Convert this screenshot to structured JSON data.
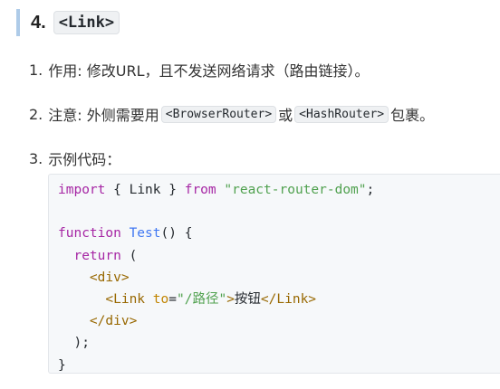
{
  "heading": {
    "number": "4.",
    "code": "<Link>"
  },
  "items": [
    {
      "num": "1.",
      "text": "作用: 修改URL，且不发送网络请求（路由链接）。"
    },
    {
      "num": "2.",
      "text_before": "注意: 外侧需要用",
      "code1": "<BrowserRouter>",
      "text_mid": "或",
      "code2": "<HashRouter>",
      "text_after": "包裹。"
    },
    {
      "num": "3.",
      "text": "示例代码："
    }
  ],
  "code": {
    "line1": {
      "import_kw": "import",
      "brace_open": " { ",
      "name": "Link",
      "brace_close": " } ",
      "from_kw": "from",
      "space": " ",
      "module": "\"react-router-dom\"",
      "semi": ";"
    },
    "line3": {
      "function_kw": "function",
      "space": " ",
      "name": "Test",
      "rest": "() {"
    },
    "line4": {
      "indent": "  ",
      "return_kw": "return",
      "rest": " ("
    },
    "line5": {
      "indent": "    ",
      "tag": "<div>"
    },
    "line6": {
      "indent": "      ",
      "tag_open": "<Link",
      "space": " ",
      "attr": "to",
      "eq": "=",
      "value": "\"/路径\"",
      "gt": ">",
      "text": "按钮",
      "tag_close": "</Link>"
    },
    "line7": {
      "indent": "    ",
      "tag": "</div>"
    },
    "line8": {
      "indent": "  ",
      "text": ");"
    },
    "line9": {
      "text": "}"
    }
  }
}
